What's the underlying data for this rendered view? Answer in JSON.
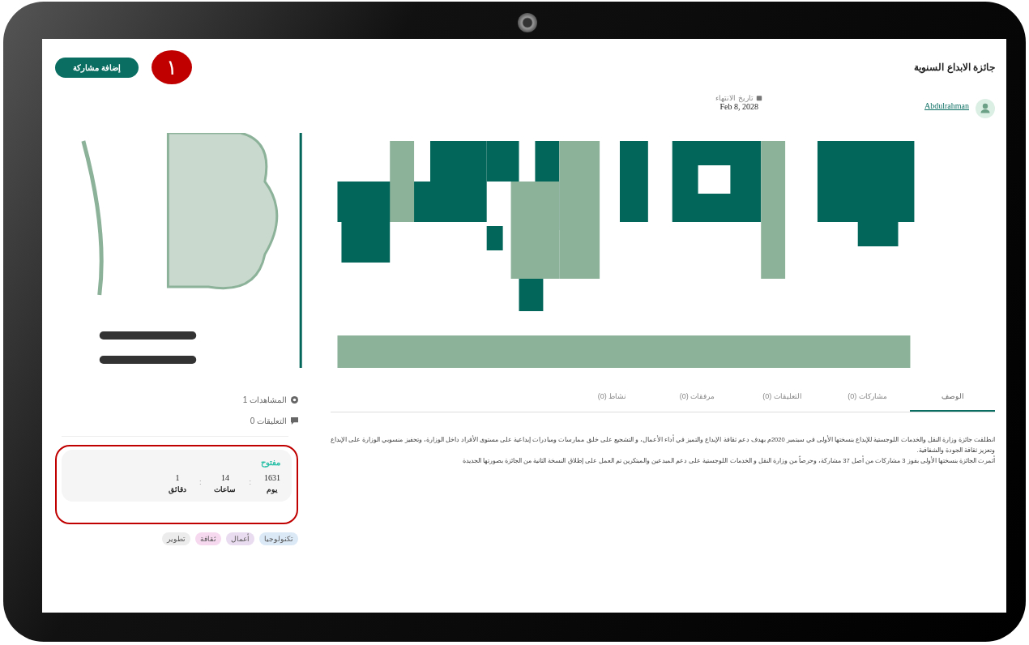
{
  "page": {
    "title": "جائزة الابداع السنوية",
    "add_button": "إضافة مشاركة",
    "annotation_badge": "١"
  },
  "author": {
    "name": "Abdulrahman"
  },
  "deadline": {
    "label": "تاريخ الانتهاء",
    "value": "Feb 8, 2028"
  },
  "tabs": [
    {
      "label": "الوصف",
      "selected": true
    },
    {
      "label": "مشاركات (0)",
      "selected": false
    },
    {
      "label": "التعليقات (0)",
      "selected": false
    },
    {
      "label": "مرفقات (0)",
      "selected": false
    },
    {
      "label": "نشاط (0)",
      "selected": false
    }
  ],
  "description": [
    "انطلقت جائزة وزارة النقل والخدمات اللوجستية للإبداع بنسختها الأولى في سبتمبر 2020م بهدف دعم ثقافة الإبداع والتميز في أداء الأعمال، و التشجيع على خلق ممارسات ومبادرات إبداعية على مستوى الأفراد داخل الوزارة، وتحفيز منسوبي الوزارة على الإبداع وتعزيز ثقافة الجودة والشفافية.",
    "أثمرت الجائزة بنسختها الأولى بفوز 3 مشاركات من أصل 37 مشاركة، وحرصاً من وزارة النقل و الخدمات اللوجستية على دعم المبدعين والمبتكرين تم العمل على إطلاق النسخة الثانية من الجائزة بصورتها الجديدة"
  ],
  "stats": [
    {
      "kind": "views",
      "label": "المشاهدات",
      "value": "1"
    },
    {
      "kind": "comments",
      "label": "التعليقات",
      "value": "0"
    }
  ],
  "countdown": {
    "status": "مفتوح",
    "separator": ":",
    "units": [
      {
        "value": "1631",
        "label": "يوم"
      },
      {
        "value": "14",
        "label": "ساعات"
      },
      {
        "value": "1",
        "label": "دقائق"
      }
    ],
    "highlighted": true
  },
  "tags": [
    {
      "label": "تكنولوجيا",
      "color": "#dbe9f7"
    },
    {
      "label": "أعمال",
      "color": "#eadcf0"
    },
    {
      "label": "ثقافة",
      "color": "#f6d8ef"
    },
    {
      "label": "تطوير",
      "color": "#ececec"
    }
  ]
}
